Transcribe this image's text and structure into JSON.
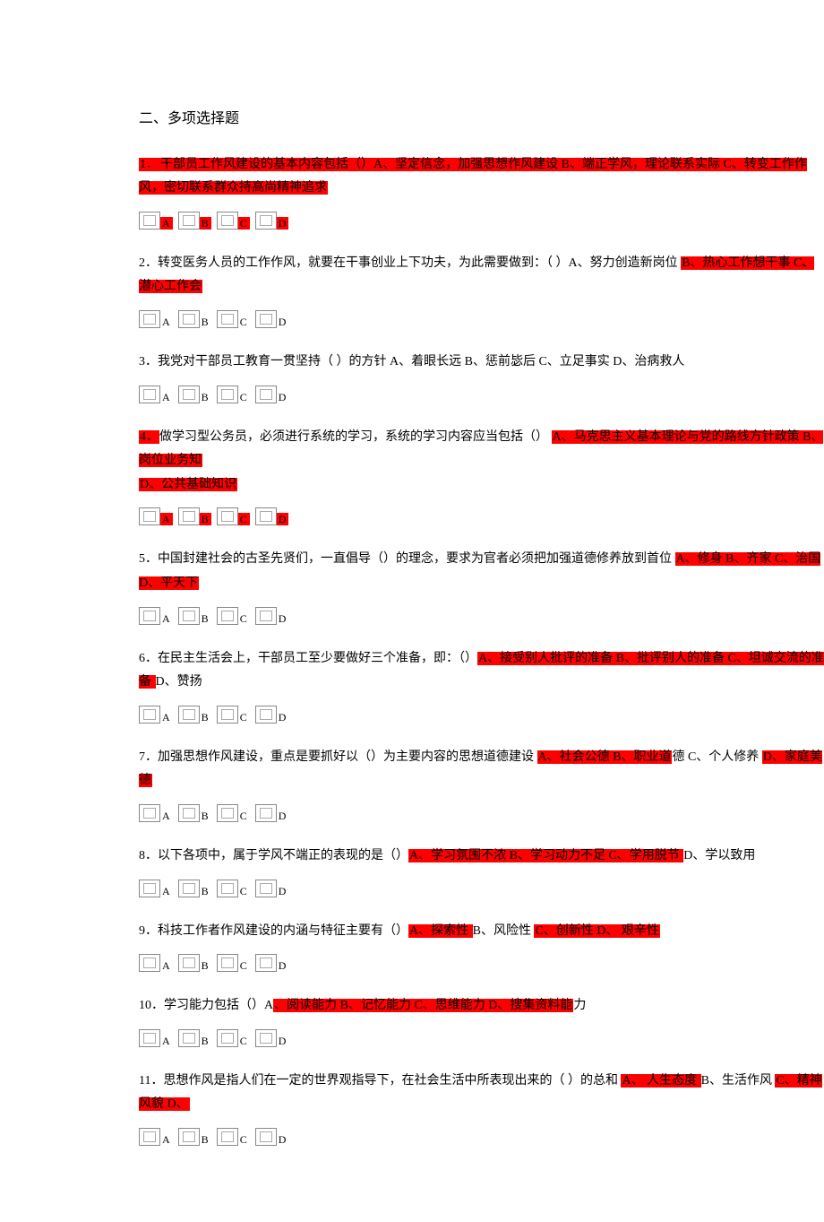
{
  "section_title": "二、多项选择题",
  "questions": [
    {
      "num": "1．",
      "text_parts": [
        {
          "t": "干部员工作风建设的基本内容包括（）A、坚定信念，加强思想作风建设 B、端正学风，理论联系实际 C、转变工作作风，密切联系群众持高尚精神追求",
          "hl": true
        }
      ],
      "num_hl": true,
      "opts": [
        "A",
        "B",
        "C",
        "D"
      ],
      "opt_hl": [
        true,
        true,
        true,
        true
      ]
    },
    {
      "num": "2．",
      "text_parts": [
        {
          "t": "转变医务人员的工作作风，就要在干事创业上下功夫，为此需要做到：（  ）A、努力创造新岗位 ",
          "hl": false
        },
        {
          "t": "B、热心工作想干事 C、潜心工作会",
          "hl": true
        }
      ],
      "num_hl": false,
      "opts": [
        "A",
        "B",
        "C",
        "D"
      ],
      "opt_hl": [
        false,
        false,
        false,
        false
      ]
    },
    {
      "num": "3．",
      "text_parts": [
        {
          "t": "我党对干部员工教育一贯坚持（  ）的方针 A、着眼长远 B、惩前毖后 C、立足事实 D、治病救人",
          "hl": false
        }
      ],
      "num_hl": false,
      "opts": [
        "A",
        "B",
        "C",
        "D"
      ],
      "opt_hl": [
        false,
        false,
        false,
        false
      ]
    },
    {
      "num": "4．",
      "text_parts": [
        {
          "t": "做学习型公务员，必须进行系统的学习，系统的学习内容应当包括（） ",
          "hl": false
        },
        {
          "t": "A、马克思主义基本理论与党的路线方针政策 B、岗位业务知",
          "hl": true
        },
        {
          "t": "\n",
          "hl": false
        },
        {
          "t": "D、公共基础知识",
          "hl": true
        }
      ],
      "num_hl": true,
      "opts": [
        "A",
        "B",
        "C",
        "D"
      ],
      "opt_hl": [
        true,
        true,
        true,
        true
      ]
    },
    {
      "num": "5．",
      "text_parts": [
        {
          "t": "中国封建社会的古圣先贤们，一直倡导（）的理念，要求为官者必须把加强道德修养放到首位 ",
          "hl": false
        },
        {
          "t": "A、修身 B、齐家 C、治国 D、平天下",
          "hl": true
        }
      ],
      "num_hl": false,
      "opts": [
        "A",
        "B",
        "C",
        "D"
      ],
      "opt_hl": [
        false,
        false,
        false,
        false
      ]
    },
    {
      "num": "6．",
      "text_parts": [
        {
          "t": "在民主生活会上，干部员工至少要做好三个准备，即：（）",
          "hl": false
        },
        {
          "t": "A、接受别人批评的准备 B、批评别人的准备 C、坦诚交流的准备 ",
          "hl": true
        },
        {
          "t": "D、赞扬",
          "hl": false
        }
      ],
      "num_hl": false,
      "opts": [
        "A",
        "B",
        "C",
        "D"
      ],
      "opt_hl": [
        false,
        false,
        false,
        false
      ]
    },
    {
      "num": "7．",
      "text_parts": [
        {
          "t": "加强思想作风建设，重点是要抓好以（）为主要内容的思想道德建设 ",
          "hl": false
        },
        {
          "t": "A、社会公德 B、职业道",
          "hl": true
        },
        {
          "t": "德 C、个人修养 ",
          "hl": false
        },
        {
          "t": "D、家庭美德",
          "hl": true
        }
      ],
      "num_hl": false,
      "opts": [
        "A",
        "B",
        "C",
        "D"
      ],
      "opt_hl": [
        false,
        false,
        false,
        false
      ]
    },
    {
      "num": "8．",
      "text_parts": [
        {
          "t": "以下各项中，属于学风不端正的表现的是（）",
          "hl": false
        },
        {
          "t": "A、学习氛围不浓 B、学习动力不足 C、学用脱节 ",
          "hl": true
        },
        {
          "t": "D、学以致用",
          "hl": false
        }
      ],
      "num_hl": false,
      "opts": [
        "A",
        "B",
        "C",
        "D"
      ],
      "opt_hl": [
        false,
        false,
        false,
        false
      ]
    },
    {
      "num": "9．",
      "text_parts": [
        {
          "t": "科技工作者作风建设的内涵与特征主要有（）",
          "hl": false
        },
        {
          "t": "A、探索性 ",
          "hl": true
        },
        {
          "t": "B、风险性 ",
          "hl": false
        },
        {
          "t": "C、创新性 D、 艰辛性",
          "hl": true
        }
      ],
      "num_hl": false,
      "opts": [
        "A",
        "B",
        "C",
        "D"
      ],
      "opt_hl": [
        false,
        false,
        false,
        false
      ]
    },
    {
      "num": "10．",
      "text_parts": [
        {
          "t": "学习能力包括（）A",
          "hl": false
        },
        {
          "t": "、阅读能力 B、记忆能力 C、思维能力 D、搜集资料能",
          "hl": true
        },
        {
          "t": "力",
          "hl": false
        }
      ],
      "num_hl": false,
      "opts": [
        "A",
        "B",
        "C",
        "D"
      ],
      "opt_hl": [
        false,
        false,
        false,
        false
      ]
    },
    {
      "num": "11．",
      "text_parts": [
        {
          "t": "思想作风是指人们在一定的世界观指导下，在社会生活中所表现出来的（  ）的总和 ",
          "hl": false
        },
        {
          "t": "A、 人生态度 ",
          "hl": true
        },
        {
          "t": "B、生活作风 ",
          "hl": false
        },
        {
          "t": "C、精神风貌 D、",
          "hl": true
        }
      ],
      "num_hl": false,
      "opts": [
        "A",
        "B",
        "C",
        "D"
      ],
      "opt_hl": [
        false,
        false,
        false,
        false
      ]
    }
  ]
}
